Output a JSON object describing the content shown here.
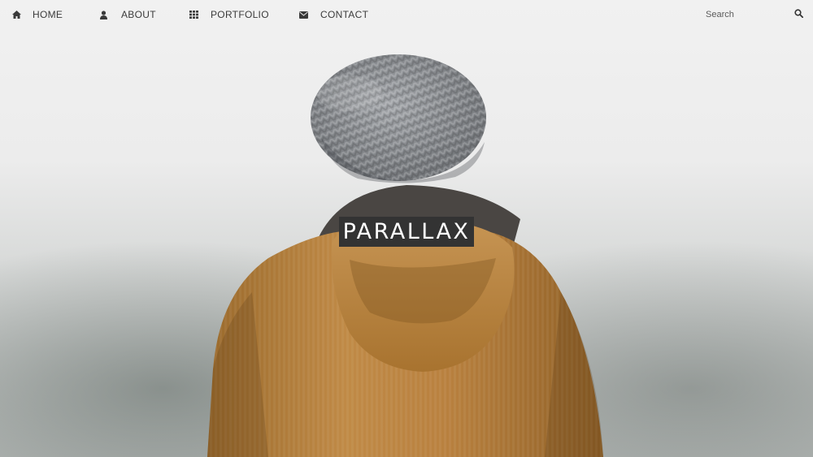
{
  "nav": {
    "items": [
      {
        "label": "HOME",
        "icon": "home-icon"
      },
      {
        "label": "ABOUT",
        "icon": "user-icon"
      },
      {
        "label": "PORTFOLIO",
        "icon": "grid-icon"
      },
      {
        "label": "CONTACT",
        "icon": "envelope-icon"
      }
    ],
    "search": {
      "placeholder": "Search",
      "icon": "search-icon"
    }
  },
  "hero": {
    "title": "PARALLAX"
  },
  "colors": {
    "nav_text": "#3a3a3a",
    "title_bg": "#333333",
    "title_text": "#ffffff",
    "jacket": "#b07a3a",
    "beanie": "#8a8d91"
  }
}
